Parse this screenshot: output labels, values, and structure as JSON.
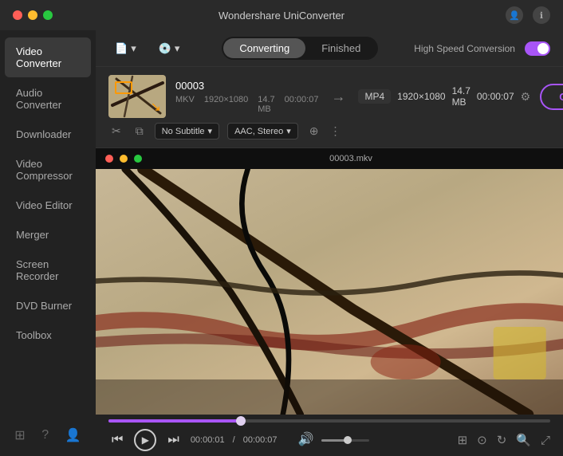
{
  "titlebar": {
    "title": "Wondershare UniConverter",
    "controls": {
      "close": "●",
      "minimize": "●",
      "maximize": "●"
    }
  },
  "toolbar": {
    "add_files_label": "📄",
    "add_files_text": "▾",
    "dvd_label": "💿",
    "dvd_text": "▾",
    "tab_converting": "Converting",
    "tab_finished": "Finished",
    "high_speed_label": "High Speed Conversion",
    "toggle_state": "on"
  },
  "sidebar": {
    "items": [
      {
        "id": "video-converter",
        "label": "Video Converter",
        "active": true
      },
      {
        "id": "audio-converter",
        "label": "Audio Converter",
        "active": false
      },
      {
        "id": "downloader",
        "label": "Downloader",
        "active": false
      },
      {
        "id": "video-compressor",
        "label": "Video Compressor",
        "active": false
      },
      {
        "id": "video-editor",
        "label": "Video Editor",
        "active": false
      },
      {
        "id": "merger",
        "label": "Merger",
        "active": false
      },
      {
        "id": "screen-recorder",
        "label": "Screen Recorder",
        "active": false
      },
      {
        "id": "dvd-burner",
        "label": "DVD Burner",
        "active": false
      },
      {
        "id": "toolbox",
        "label": "Toolbox",
        "active": false
      }
    ],
    "bottom_icons": [
      "⊞",
      "?",
      "👤"
    ]
  },
  "file": {
    "name": "00003",
    "source_format": "MKV",
    "source_resolution": "1920×1080",
    "source_size": "14.7 MB",
    "source_duration": "00:00:07",
    "output_format": "MP4",
    "output_resolution": "1920×1080",
    "output_size": "14.7 MB",
    "output_duration": "00:00:07",
    "subtitle": "No Subtitle",
    "audio": "AAC, Stereo",
    "convert_label": "Convert"
  },
  "video_preview": {
    "filename": "00003.mkv",
    "traffic_lights": [
      "red",
      "yellow",
      "green"
    ]
  },
  "controls": {
    "rewind": "⏮",
    "play": "▶",
    "forward": "⏭",
    "current_time": "00:00:01",
    "total_time": "00:00:07",
    "volume_icon": "🔊",
    "fullscreen": "⛶",
    "screenshot": "⊙",
    "rotate": "↻",
    "zoom_icon": "🔍",
    "expand": "⤢"
  }
}
